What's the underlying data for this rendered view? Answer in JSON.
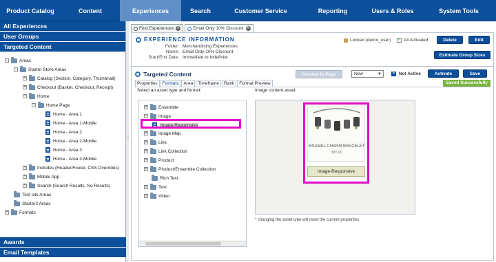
{
  "nav": {
    "items": [
      {
        "label": "Product Catalog",
        "width": 88
      },
      {
        "label": "Content",
        "width": 86
      },
      {
        "label": "Experiences",
        "width": 89,
        "active": true
      },
      {
        "label": "Search",
        "width": 56
      },
      {
        "label": "Customer Service",
        "width": 119
      },
      {
        "label": "Reporting",
        "width": 90
      },
      {
        "label": "Users & Roles",
        "width": 84
      },
      {
        "label": "System Tools",
        "width": 108
      }
    ]
  },
  "sidebar": {
    "all_experiences": "All Experiences",
    "user_groups": "User Groups",
    "targeted_content": "Targeted Content",
    "awards": "Awards",
    "email_templates": "Email Templates",
    "tree": {
      "areas": "Areas",
      "starter_store_areas": "Starter Store Areas",
      "catalog": "Catalog (Section, Category, Thumbnail)",
      "checkout": "Checkout (Basket, Checkout, Receipt)",
      "home": "Home",
      "home_page": "Home Page",
      "area1": "Home - Area 1",
      "area1m": "Home - Area 1-Mobile",
      "area2": "Home - Area 2",
      "area2m": "Home - Area 2-Mobile",
      "area3": "Home - Area 3",
      "area3m": "Home - Area 3-Mobile",
      "includes": "Includes (Header/Footer, CSS Overrides)",
      "mobile_app": "Mobile App",
      "search": "Search (Search Results, No Results)",
      "test_site": "Test site Areas",
      "starter2": "Starter2 Areas",
      "formats": "Formats"
    }
  },
  "tabs": {
    "find": "Find Experiences",
    "email": "Email Only 10% Discount"
  },
  "info": {
    "title": "EXPERIENCE INFORMATION",
    "folder_label": "Folder:",
    "folder_value": "Merchandising Experiences",
    "name_label": "Name:",
    "name_value": "Email Only 20% Discount",
    "dates_label": "Start/End Date:",
    "dates_value": "Immediate to Indefinite",
    "locked": "Locked (demo_user)",
    "activated": "All Activated",
    "delete": "Delete",
    "edit": "Edit",
    "estimate": "Estimate Group Sizes"
  },
  "content": {
    "title": "Targeted Content",
    "preview": "Preview In Page",
    "state": "New",
    "not_active": "Not Active",
    "activate": "Activate",
    "save": "Save",
    "saved": "Saved Successfully",
    "tabs": [
      "Properties",
      "Formats",
      "Area",
      "Timeframe",
      "Rank",
      "Format Preview"
    ],
    "select_label": "Select an asset type and format:",
    "image_label": "Image content asset:",
    "assets": {
      "ensemble": "Ensemble",
      "image": "Image",
      "image_responsive": "Image-Responsive",
      "image_map": "Image Map",
      "link": "Link",
      "link_collection": "Link Collection",
      "product": "Product",
      "product_ensemble": "Product/Ensemble Collection",
      "rich_text": "Rich Text",
      "text": "Text",
      "video": "Video"
    },
    "card_product": "ENAMEL CHARM BRACELET",
    "card_price": "$55.00",
    "card_caption": "Image-Responsive",
    "note": "* changing the asset type will reset the current properties"
  },
  "colors": {
    "nav": "#0c4f9a",
    "highlight": "#e30ac7",
    "saved": "#7bb441"
  }
}
